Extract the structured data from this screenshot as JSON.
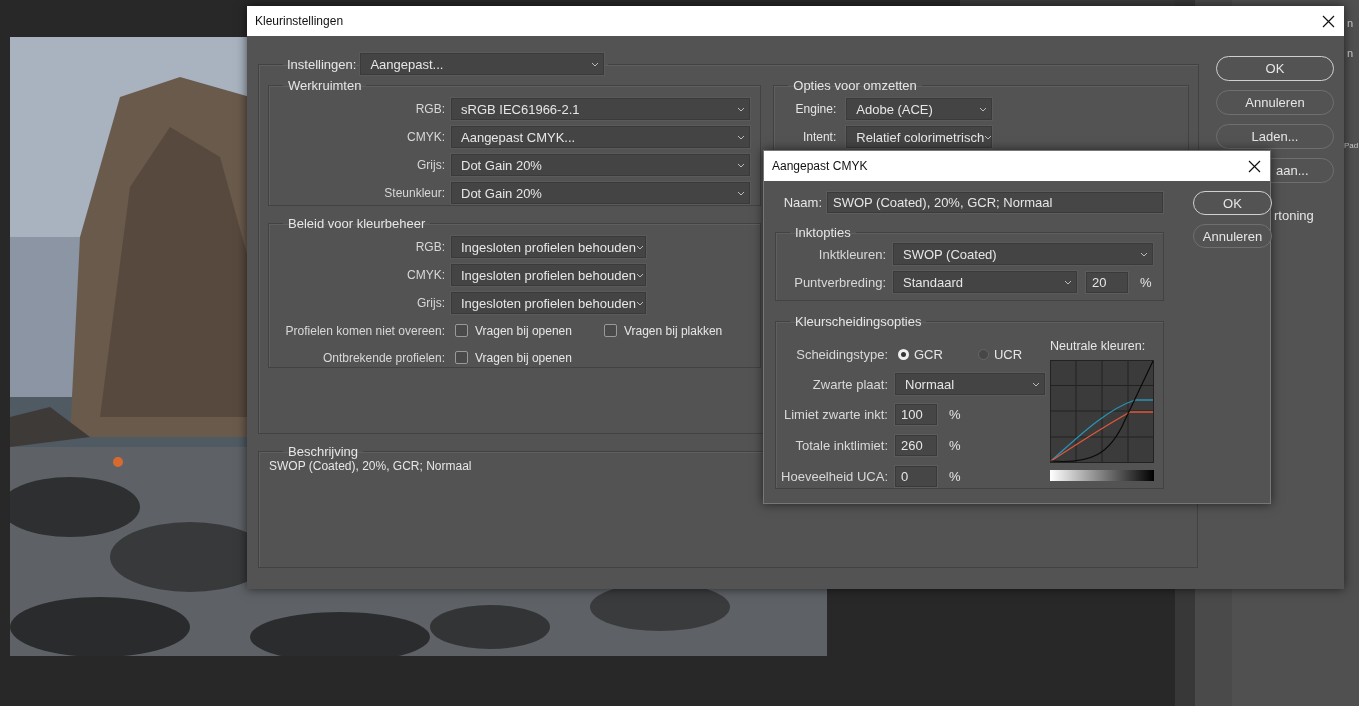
{
  "background": {
    "side_labels": [
      "n",
      "n",
      "Pad"
    ]
  },
  "main_dialog": {
    "title": "Kleurinstellingen",
    "settings": {
      "label": "Instellingen:",
      "value": "Aangepast..."
    },
    "working_spaces": {
      "title": "Werkruimten",
      "rows": [
        {
          "label": "RGB:",
          "value": "sRGB IEC61966-2.1"
        },
        {
          "label": "CMYK:",
          "value": "Aangepast CMYK..."
        },
        {
          "label": "Grijs:",
          "value": "Dot Gain 20%"
        },
        {
          "label": "Steunkleur:",
          "value": "Dot Gain 20%"
        }
      ]
    },
    "conversion_options": {
      "title": "Opties voor omzetten",
      "rows": [
        {
          "label": "Engine:",
          "value": "Adobe (ACE)"
        },
        {
          "label": "Intent:",
          "value": "Relatief colorimetrisch"
        }
      ]
    },
    "policies": {
      "title": "Beleid voor kleurbeheer",
      "rows": [
        {
          "label": "RGB:",
          "value": "Ingesloten profielen behouden"
        },
        {
          "label": "CMYK:",
          "value": "Ingesloten profielen behouden"
        },
        {
          "label": "Grijs:",
          "value": "Ingesloten profielen behouden"
        }
      ],
      "checks": [
        {
          "label": "Profielen komen niet overeen:",
          "options": [
            {
              "label": "Vragen bij openen",
              "checked": false
            },
            {
              "label": "Vragen bij plakken",
              "checked": false
            }
          ]
        },
        {
          "label": "Ontbrekende profielen:",
          "options": [
            {
              "label": "Vragen bij openen",
              "checked": false
            }
          ]
        }
      ]
    },
    "description": {
      "title": "Beschrijving",
      "text": "SWOP (Coated), 20%, GCR; Normaal"
    },
    "buttons": [
      {
        "label": "OK",
        "default": true
      },
      {
        "label": "Annuleren",
        "default": false
      },
      {
        "label": "Laden...",
        "default": false
      },
      {
        "label": "aan...",
        "default": false
      }
    ],
    "preview_label": "rtoning"
  },
  "sub_dialog": {
    "title": "Aangepast CMYK",
    "name": {
      "label": "Naam:",
      "value": "SWOP (Coated), 20%, GCR; Normaal"
    },
    "ink_options": {
      "title": "Inktopties",
      "ink_colors": {
        "label": "Inktkleuren:",
        "value": "SWOP (Coated)"
      },
      "dot_gain": {
        "label": "Puntverbreding:",
        "value": "Standaard",
        "amount": "20",
        "unit": "%"
      }
    },
    "separation": {
      "title": "Kleurscheidingsopties",
      "type_label": "Scheidingstype:",
      "types": [
        {
          "label": "GCR",
          "selected": true
        },
        {
          "label": "UCR",
          "selected": false
        }
      ],
      "black_generation": {
        "label": "Zwarte plaat:",
        "value": "Normaal"
      },
      "fields": [
        {
          "label": "Limiet zwarte inkt:",
          "value": "100",
          "unit": "%"
        },
        {
          "label": "Totale inktlimiet:",
          "value": "260",
          "unit": "%"
        },
        {
          "label": "Hoeveelheid UCA:",
          "value": "0",
          "unit": "%"
        }
      ],
      "graph_title": "Neutrale kleuren:"
    },
    "buttons": [
      {
        "label": "OK",
        "default": true
      },
      {
        "label": "Annuleren",
        "default": false
      }
    ]
  }
}
